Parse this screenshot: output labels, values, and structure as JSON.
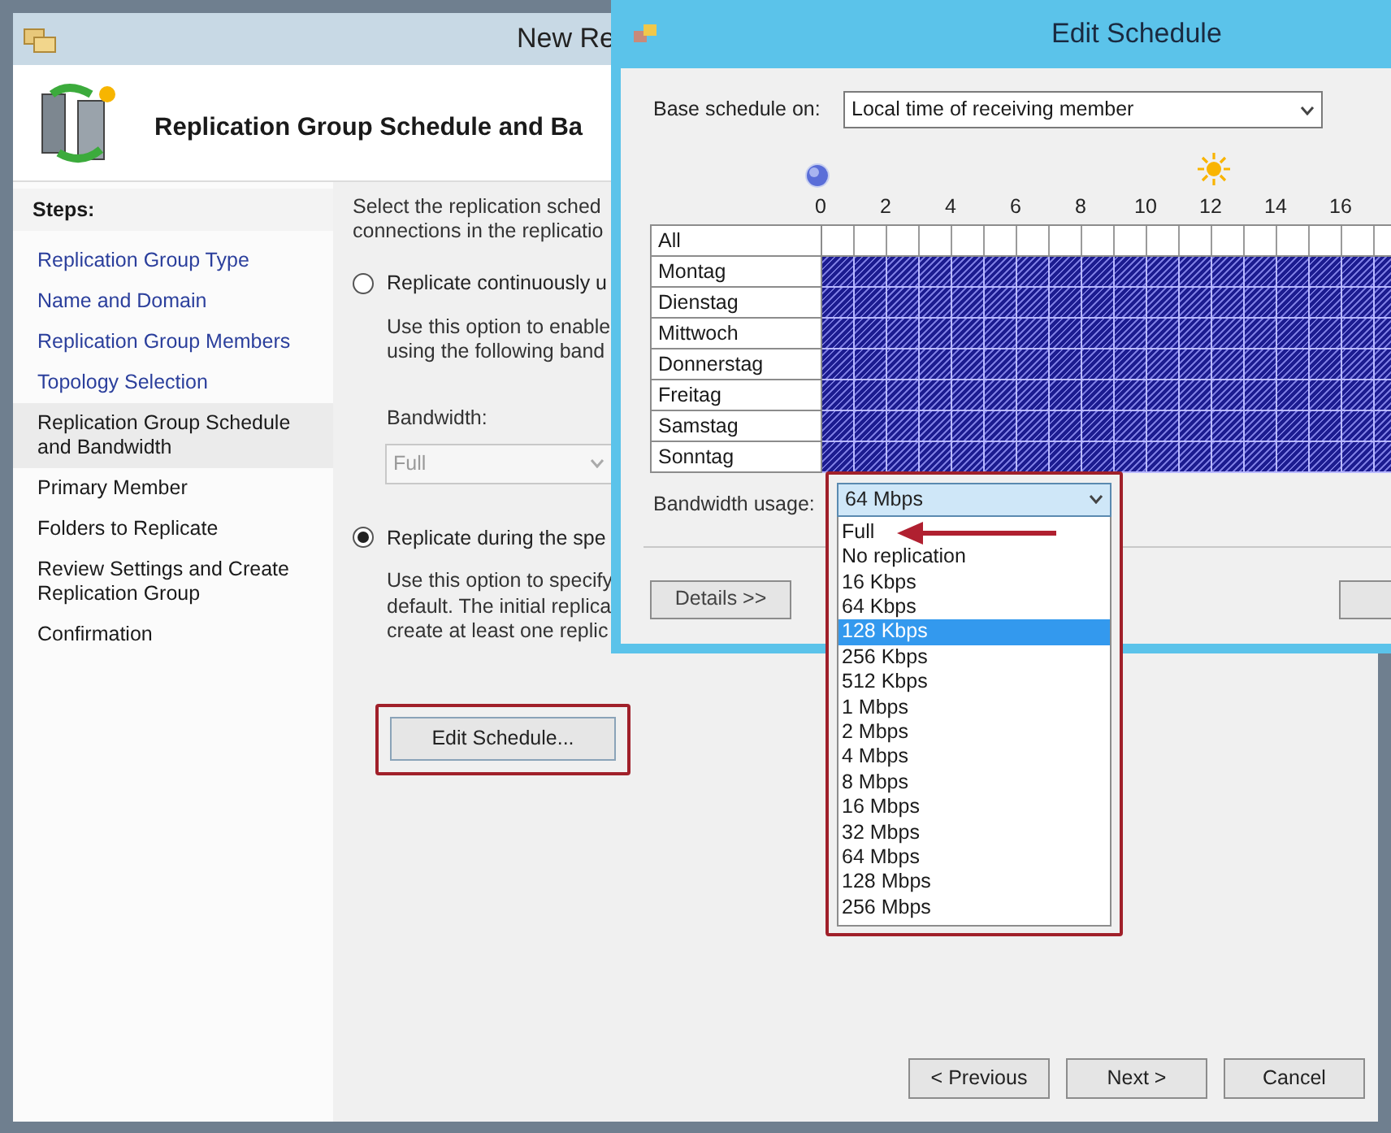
{
  "wizard": {
    "title": "New Re",
    "heading": "Replication Group Schedule and Ba",
    "steps_label": "Steps:",
    "steps": [
      {
        "label": "Replication Group Type",
        "visited": true,
        "selected": false
      },
      {
        "label": "Name and Domain",
        "visited": true,
        "selected": false
      },
      {
        "label": "Replication Group Members",
        "visited": true,
        "selected": false
      },
      {
        "label": "Topology Selection",
        "visited": true,
        "selected": false
      },
      {
        "label": "Replication Group Schedule and Bandwidth",
        "visited": false,
        "selected": true
      },
      {
        "label": "Primary Member",
        "visited": false,
        "selected": false
      },
      {
        "label": "Folders to Replicate",
        "visited": false,
        "selected": false
      },
      {
        "label": "Review Settings and Create Replication Group",
        "visited": false,
        "selected": false
      },
      {
        "label": "Confirmation",
        "visited": false,
        "selected": false
      }
    ],
    "intro": [
      "Select the replication sched",
      "connections in the replicatio"
    ],
    "options": [
      {
        "kind": "bandwidth",
        "label": "Replicate continuously u",
        "selected": false,
        "description": [
          "Use this option to enable",
          "using the following band"
        ],
        "bandwidth_label": "Bandwidth:",
        "bandwidth_value": "Full",
        "disabled": true
      },
      {
        "kind": "schedule",
        "label": "Replicate during the spe",
        "selected": true,
        "description": [
          "Use this option to specify",
          "default. The initial replica",
          "create at least one replic"
        ],
        "button": "Edit Schedule..."
      }
    ],
    "buttons": [
      "< Previous",
      "Next >",
      "Cancel"
    ]
  },
  "dialog": {
    "title": "Edit Schedule",
    "base_label": "Base schedule on:",
    "base_value": "Local time of receiving member",
    "hours": [
      "0",
      "2",
      "4",
      "6",
      "8",
      "10",
      "12",
      "14",
      "16"
    ],
    "all_label": "All",
    "days": [
      {
        "label": "Montag",
        "scheduled": true
      },
      {
        "label": "Dienstag",
        "scheduled": true
      },
      {
        "label": "Mittwoch",
        "scheduled": true
      },
      {
        "label": "Donnerstag",
        "scheduled": true
      },
      {
        "label": "Freitag",
        "scheduled": true
      },
      {
        "label": "Samstag",
        "scheduled": true
      },
      {
        "label": "Sonntag",
        "scheduled": true
      }
    ],
    "bandwidth_label": "Bandwidth usage:",
    "bandwidth_value": "64 Mbps",
    "bandwidth_options": [
      {
        "label": "Full",
        "selected": false
      },
      {
        "label": "No replication",
        "selected": false
      },
      {
        "label": "16 Kbps",
        "selected": false
      },
      {
        "label": "64 Kbps",
        "selected": false
      },
      {
        "label": "128 Kbps",
        "selected": true
      },
      {
        "label": "256 Kbps",
        "selected": false
      },
      {
        "label": "512 Kbps",
        "selected": false
      },
      {
        "label": "1 Mbps",
        "selected": false
      },
      {
        "label": "2 Mbps",
        "selected": false
      },
      {
        "label": "4 Mbps",
        "selected": false
      },
      {
        "label": "8 Mbps",
        "selected": false
      },
      {
        "label": "16 Mbps",
        "selected": false
      },
      {
        "label": "32 Mbps",
        "selected": false
      },
      {
        "label": "64 Mbps",
        "selected": false
      },
      {
        "label": "128 Mbps",
        "selected": false
      },
      {
        "label": "256 Mbps",
        "selected": false
      }
    ],
    "details_button": "Details >>"
  }
}
